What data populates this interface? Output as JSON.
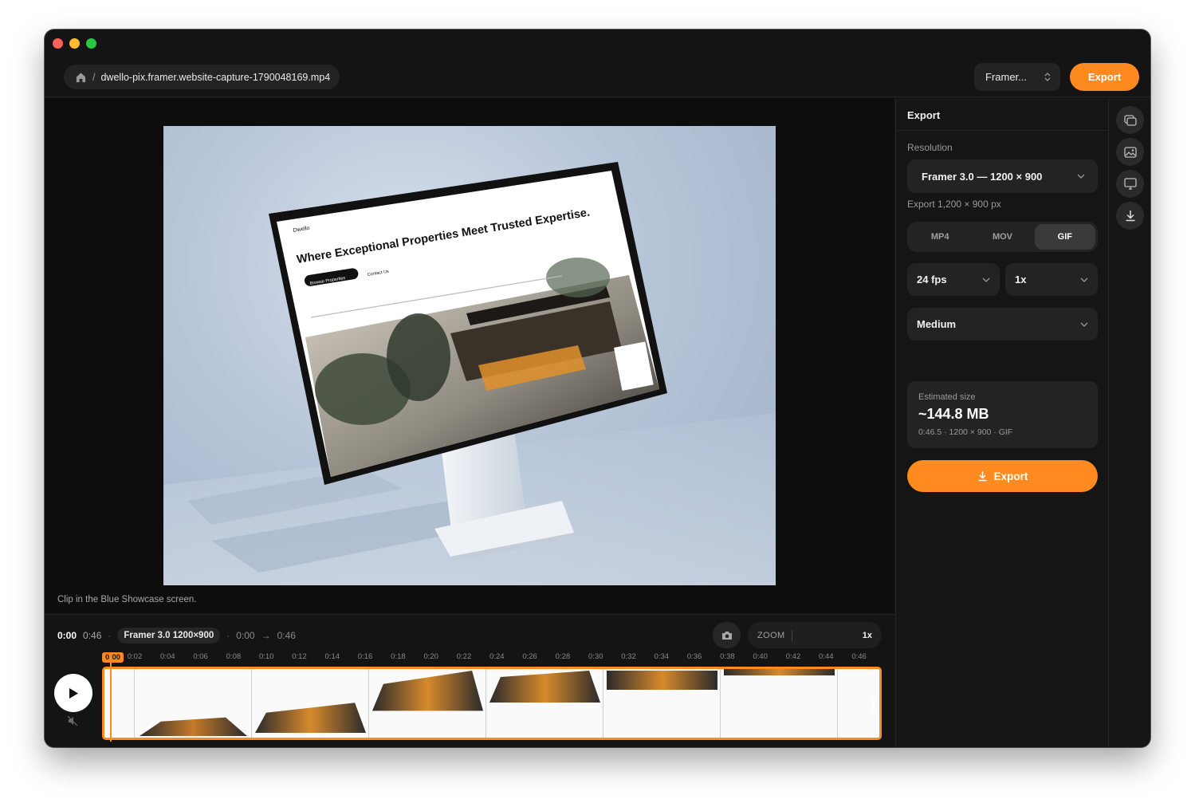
{
  "window": {
    "traffic_lights": [
      "close",
      "minimize",
      "zoom"
    ]
  },
  "header": {
    "home_icon": "home-icon",
    "breadcrumb_sep": "/",
    "file_name": "dwello-pix.framer.website-capture-1790048169.mp4",
    "preset": "Framer...",
    "export_label": "Export"
  },
  "preview": {
    "caption": "Clip in the Blue Showcase screen.",
    "screen": {
      "brand": "Dwello",
      "headline": "Where Exceptional Properties Meet Trusted Expertise.",
      "cta": "Browse Properties",
      "secondary": "Contact Us"
    }
  },
  "timeline": {
    "current_time": "0:00",
    "duration": "0:46",
    "dot": "·",
    "preset_chip": "Framer 3.0 1200×900",
    "range_start": "0:00",
    "range_arrow": "→",
    "range_end": "0:46",
    "zoom_label": "ZOOM",
    "zoom_value": "1x",
    "playhead_label": "0:00",
    "ruler": [
      "0:02",
      "0:04",
      "0:06",
      "0:08",
      "0:10",
      "0:12",
      "0:14",
      "0:16",
      "0:18",
      "0:20",
      "0:22",
      "0:24",
      "0:26",
      "0:28",
      "0:30",
      "0:32",
      "0:34",
      "0:36",
      "0:38",
      "0:40",
      "0:42",
      "0:44",
      "0:46"
    ]
  },
  "panel": {
    "title": "Export",
    "resolution_label": "Resolution",
    "resolution_value": "Framer 3.0 — 1200 × 900",
    "resolution_note": "Export 1,200 × 900 px",
    "formats": [
      "MP4",
      "MOV",
      "GIF"
    ],
    "active_format": "GIF",
    "fps": "24 fps",
    "speed": "1x",
    "quality": "Medium",
    "estimate_label": "Estimated size",
    "estimate_value": "~144.8 MB",
    "estimate_meta": "0:46.5 · 1200 × 900 · GIF",
    "export_label": "Export"
  },
  "rail": {
    "buttons": [
      "copy-icon",
      "image-icon",
      "monitor-icon",
      "download-icon"
    ]
  },
  "colors": {
    "accent": "#ff8a1f",
    "bg": "#141414",
    "surface": "#232323"
  }
}
